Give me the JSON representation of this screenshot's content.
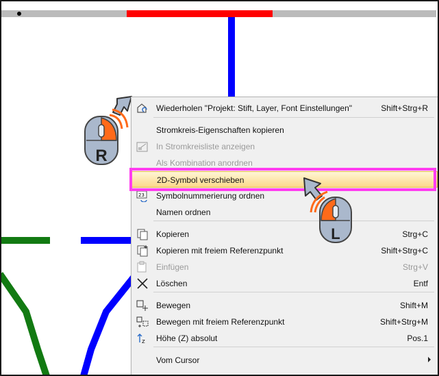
{
  "mouse_right_label": "R",
  "mouse_left_label": "L",
  "menu": {
    "items": [
      {
        "label": "Wiederholen \"Projekt: Stift, Layer, Font Einstellungen\"",
        "shortcut": "Shift+Strg+R",
        "icon": "repeat-icon"
      },
      {
        "label": "Stromkreis-Eigenschaften kopieren",
        "shortcut": "",
        "icon": ""
      },
      {
        "label": "In Stromkreisliste anzeigen",
        "shortcut": "",
        "icon": "list-icon"
      },
      {
        "label": "Als Kombination anordnen",
        "shortcut": "",
        "icon": ""
      },
      {
        "label": "2D-Symbol verschieben",
        "shortcut": "",
        "icon": ""
      },
      {
        "label": "Symbolnummerierung ordnen",
        "shortcut": "",
        "icon": "numbering-icon"
      },
      {
        "label": "Namen ordnen",
        "shortcut": "",
        "icon": ""
      },
      {
        "label": "Kopieren",
        "shortcut": "Strg+C",
        "icon": "copy-icon"
      },
      {
        "label": "Kopieren mit freiem Referenzpunkt",
        "shortcut": "Shift+Strg+C",
        "icon": "copy-ref-icon"
      },
      {
        "label": "Einfügen",
        "shortcut": "Strg+V",
        "icon": "paste-icon"
      },
      {
        "label": "Löschen",
        "shortcut": "Entf",
        "icon": "delete-icon"
      },
      {
        "label": "Bewegen",
        "shortcut": "Shift+M",
        "icon": "move-icon"
      },
      {
        "label": "Bewegen mit freiem Referenzpunkt",
        "shortcut": "Shift+Strg+M",
        "icon": "move-ref-icon"
      },
      {
        "label": "Höhe (Z) absolut",
        "shortcut": "Pos.1",
        "icon": "height-icon"
      },
      {
        "label": "Vom Cursor",
        "shortcut": "",
        "icon": "chevron-right-icon"
      }
    ]
  },
  "colors": {
    "accent_highlight": "#ff3df0",
    "wire_red": "#ff0000",
    "wire_blue": "#0000ff",
    "wire_green": "#127a12",
    "wire_grey": "#bbbbbb"
  }
}
